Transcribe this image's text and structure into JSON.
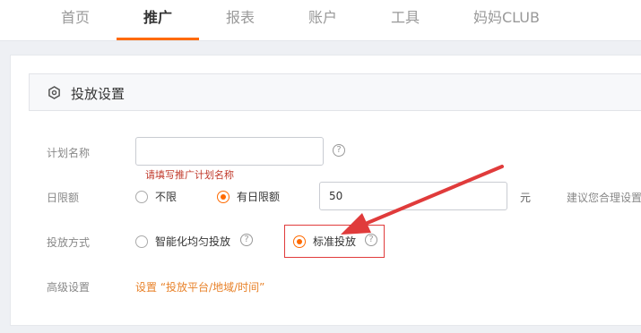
{
  "nav": {
    "items": [
      "首页",
      "推广",
      "报表",
      "账户",
      "工具",
      "妈妈CLUB"
    ],
    "active_index": 1
  },
  "section": {
    "icon": "hexagon-settings-icon",
    "title": "投放设置"
  },
  "form": {
    "plan_name": {
      "label": "计划名称",
      "value": "",
      "error": "请填写推广计划名称"
    },
    "daily_limit": {
      "label": "日限额",
      "options": [
        "不限",
        "有日限额"
      ],
      "selected": "有日限额",
      "value": "50",
      "unit": "元",
      "hint": "建议您合理设置"
    },
    "delivery_method": {
      "label": "投放方式",
      "options": [
        "智能化均匀投放",
        "标准投放"
      ],
      "selected": "标准投放"
    },
    "advanced": {
      "label": "高级设置",
      "link": "设置 “投放平台/地域/时间”"
    }
  },
  "colors": {
    "accent": "#ff6a00",
    "annotation": "#e03b3b",
    "link": "#e8822a"
  }
}
